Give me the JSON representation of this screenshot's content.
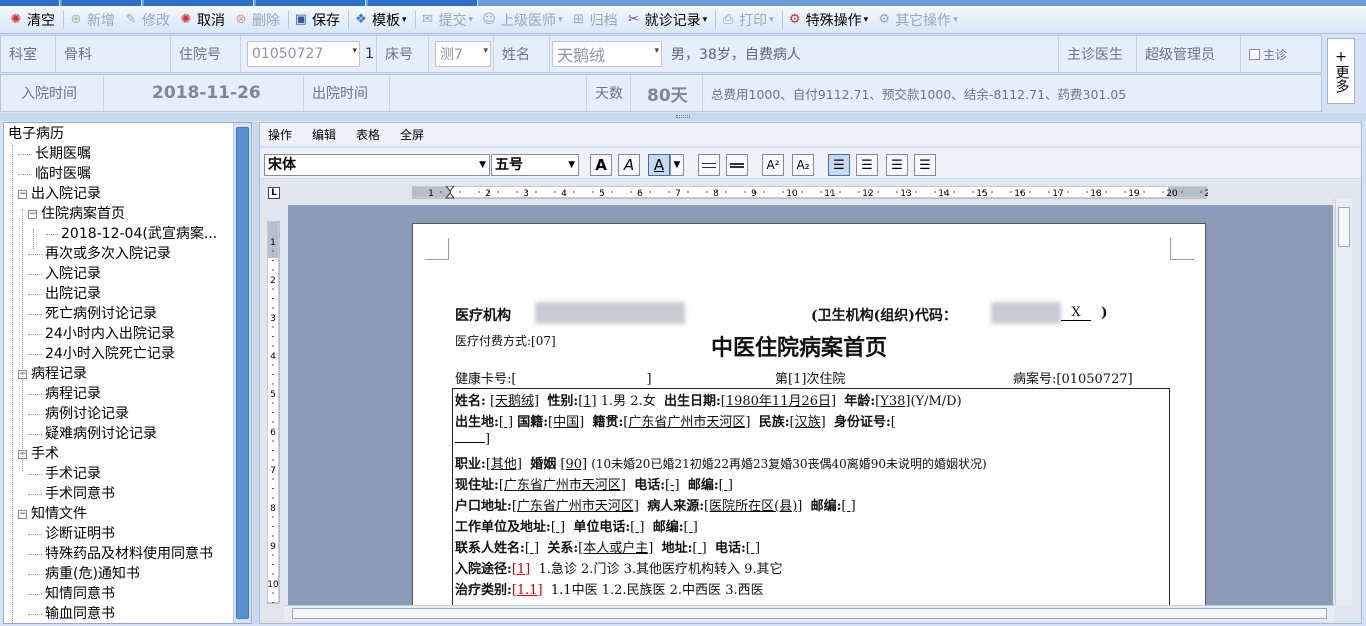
{
  "toolbar": {
    "clear": "清空",
    "add": "新增",
    "edit": "修改",
    "cancel": "取消",
    "delete": "删除",
    "save": "保存",
    "template": "模板",
    "submit": "提交",
    "superior_doctor": "上级医师",
    "archive": "归档",
    "visit_record": "就诊记录",
    "print": "打印",
    "special_ops": "特殊操作",
    "other_ops": "其它操作"
  },
  "info": {
    "dept_label": "科室",
    "dept_value": "骨科",
    "admission_no_label": "住院号",
    "admission_no_value": "01050727",
    "admission_seq": "1",
    "bed_label": "床号",
    "bed_value": "测7",
    "name_label": "姓名",
    "name_value": "天鹅绒",
    "patient_desc": "男，38岁，自费病人",
    "attending_label": "主诊医生",
    "attending_value": "超级管理员",
    "attending_check": "主诊",
    "more": "更多",
    "admit_time_label": "入院时间",
    "admit_time_value": "2018-11-26",
    "discharge_time_label": "出院时间",
    "days_label": "天数",
    "days_value": "80天",
    "fee_summary": "总费用1000、自付9112.71、预交款1000、结余-8112.71、药费301.05"
  },
  "tree": [
    {
      "label": "电子病历",
      "level": 0,
      "toggle": ""
    },
    {
      "label": "长期医嘱",
      "level": 1,
      "toggle": ""
    },
    {
      "label": "临时医嘱",
      "level": 1,
      "toggle": ""
    },
    {
      "label": "出入院记录",
      "level": 1,
      "toggle": "−"
    },
    {
      "label": "住院病案首页",
      "level": 2,
      "toggle": "−"
    },
    {
      "label": "2018-12-04(武宣病案...",
      "level": 3,
      "toggle": ""
    },
    {
      "label": "再次或多次入院记录",
      "level": 2,
      "toggle": ""
    },
    {
      "label": "入院记录",
      "level": 2,
      "toggle": ""
    },
    {
      "label": "出院记录",
      "level": 2,
      "toggle": ""
    },
    {
      "label": "死亡病例讨论记录",
      "level": 2,
      "toggle": ""
    },
    {
      "label": "24小时内入出院记录",
      "level": 2,
      "toggle": ""
    },
    {
      "label": "24小时入院死亡记录",
      "level": 2,
      "toggle": ""
    },
    {
      "label": "病程记录",
      "level": 1,
      "toggle": "−"
    },
    {
      "label": "病程记录",
      "level": 2,
      "toggle": ""
    },
    {
      "label": "病例讨论记录",
      "level": 2,
      "toggle": ""
    },
    {
      "label": "疑难病例讨论记录",
      "level": 2,
      "toggle": ""
    },
    {
      "label": "手术",
      "level": 1,
      "toggle": "−"
    },
    {
      "label": "手术记录",
      "level": 2,
      "toggle": ""
    },
    {
      "label": "手术同意书",
      "level": 2,
      "toggle": ""
    },
    {
      "label": "知情文件",
      "level": 1,
      "toggle": "−"
    },
    {
      "label": "诊断证明书",
      "level": 2,
      "toggle": ""
    },
    {
      "label": "特殊药品及材料使用同意书",
      "level": 2,
      "toggle": ""
    },
    {
      "label": "病重(危)通知书",
      "level": 2,
      "toggle": ""
    },
    {
      "label": "知情同意书",
      "level": 2,
      "toggle": ""
    },
    {
      "label": "输血同意书",
      "level": 2,
      "toggle": ""
    }
  ],
  "editor_menu": [
    "操作",
    "编辑",
    "表格",
    "全屏"
  ],
  "format": {
    "font_family": "宋体",
    "font_size": "五号",
    "bold": "A",
    "italic": "A",
    "underline": "A",
    "superscript": "A²",
    "subscript": "A₂"
  },
  "ruler_h_numbers": [
    "1",
    "2",
    "3",
    "4",
    "5",
    "6",
    "7",
    "8",
    "9",
    "10",
    "11",
    "12",
    "13",
    "14",
    "15",
    "16",
    "17",
    "18",
    "19",
    "20",
    "21"
  ],
  "ruler_v_numbers": [
    "1",
    "2",
    "3",
    "4",
    "5",
    "6",
    "7",
    "8",
    "9",
    "10"
  ],
  "doc": {
    "org_label": "医疗机构",
    "org_code_label": "(卫生机构(组织)代码：",
    "org_code_suffix": "X",
    "org_code_close": ")",
    "payment_line": "医疗付费方式:[07]",
    "title": "中医住院病案首页",
    "health_card": "健康卡号:[",
    "health_card_close": "]",
    "admission_times": "第[1]次住院",
    "case_no": "病案号:[01050727]",
    "row1": {
      "name_l": "姓名:",
      "name_v": "[天鹅绒]",
      "sex_l": "性别:",
      "sex_v": "[1]",
      "sex_opts": "1.男 2.女",
      "dob_l": "出生日期:",
      "dob_v": "[1980年11月26日]",
      "age_l": "年龄:",
      "age_v": "[Y38]",
      "age_unit": "(Y/M/D)"
    },
    "row2": {
      "birth_l": "出生地:",
      "birth_v": "[          ]",
      "nation_l": "国籍:",
      "nation_v": "[中国]",
      "native_l": "籍贯:",
      "native_v": "[广东省广州市天河区]",
      "ethnic_l": "民族:",
      "ethnic_v": "[汉族]",
      "id_l": "身份证号:",
      "id_v": "["
    },
    "row2b": "]",
    "row3": {
      "job_l": "职业:",
      "job_v": "[其他]",
      "marry_l": "婚姻",
      "marry_v": "[90]",
      "marry_note": "(10未婚20已婚21初婚22再婚23复婚30丧偶40离婚90未说明的婚姻状况)"
    },
    "row4": {
      "addr_l": "现住址:",
      "addr_v": "[广东省广州市天河区]",
      "phone_l": "电话:",
      "phone_v": "[-]",
      "zip_l": "邮编:",
      "zip_v": "[      ]"
    },
    "row5": {
      "reg_l": "户口地址:",
      "reg_v": "[广东省广州市天河区]",
      "source_l": "病人来源:",
      "source_v": "[医院所在区(县)]",
      "zip_l": "邮编:",
      "zip_v": "[      ]"
    },
    "row6": {
      "work_l": "工作单位及地址:",
      "work_v": "[          ]",
      "wphone_l": "单位电话:",
      "wphone_v": "[          ]",
      "zip_l": "邮编:",
      "zip_v": "[      ]"
    },
    "row7": {
      "contact_l": "联系人姓名:",
      "contact_v": "[    ]",
      "rel_l": "关系:",
      "rel_v": "[本人或户主]",
      "caddr_l": "地址:",
      "caddr_v": "[          ]",
      "cphone_l": "电话:",
      "cphone_v": "[          ]"
    },
    "row8": {
      "route_l": "入院途径:",
      "route_v": "[1]",
      "route_opts": "1.急诊 2.门诊 3.其他医疗机构转入 9.其它"
    },
    "row9": {
      "treat_l": "治疗类别:",
      "treat_v": "[1.1]",
      "treat_opts": "1.1中医 1.2.民族医 2.中西医 3.西医"
    }
  }
}
